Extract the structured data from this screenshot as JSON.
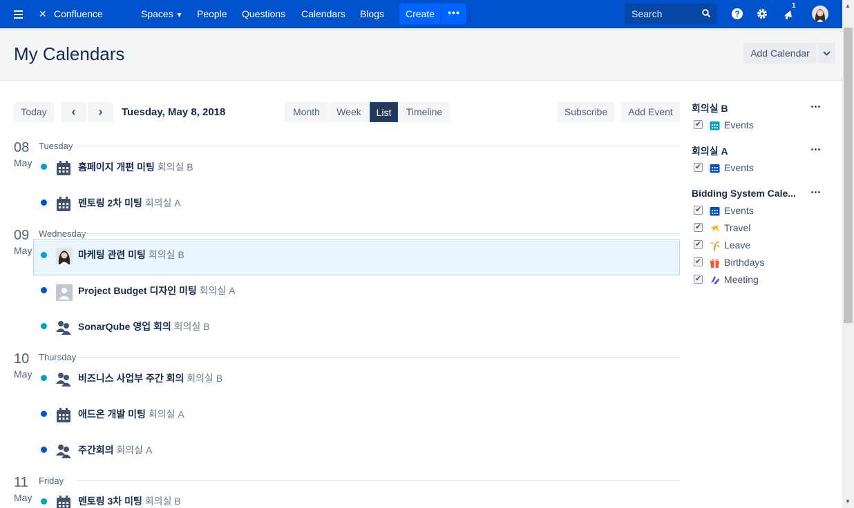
{
  "nav": {
    "brand": "Confluence",
    "spaces": "Spaces",
    "people": "People",
    "questions": "Questions",
    "calendars": "Calendars",
    "blogs": "Blogs",
    "create": "Create",
    "more": "•••",
    "search_placeholder": "Search",
    "notifications_count": "1"
  },
  "header": {
    "title": "My Calendars",
    "add_calendar": "Add Calendar"
  },
  "toolbar": {
    "today": "Today",
    "prev": "‹",
    "next": "›",
    "current_date": "Tuesday, May 8, 2018",
    "views": [
      "Month",
      "Week",
      "List",
      "Timeline"
    ],
    "active_view": "List",
    "subscribe": "Subscribe",
    "add_event": "Add Event"
  },
  "days": [
    {
      "num": "08",
      "month": "May",
      "weekday": "Tuesday",
      "events": [
        {
          "title": "홈페이지 개편 미팅",
          "room": "회의실 B",
          "color": "#00a3bf",
          "icon": "calendar-icon"
        },
        {
          "title": "멘토링 2차 미팅",
          "room": "회의실 A",
          "color": "#0052cc",
          "icon": "calendar-icon"
        }
      ]
    },
    {
      "num": "09",
      "month": "May",
      "weekday": "Wednesday",
      "events": [
        {
          "title": "마케팅 관련 미팅",
          "room": "회의실 B",
          "color": "#00a3bf",
          "icon": "user-photo"
        },
        {
          "title": "Project Budget 디자인 미팅",
          "room": "회의실 A",
          "color": "#0052cc",
          "icon": "default-avatar-icon"
        },
        {
          "title": "SonarQube 영업 회의",
          "room": "회의실 B",
          "color": "#00a3bf",
          "icon": "people-icon"
        }
      ]
    },
    {
      "num": "10",
      "month": "May",
      "weekday": "Thursday",
      "events": [
        {
          "title": "비즈니스 사업부 주간 회의",
          "room": "회의실 B",
          "color": "#00a3bf",
          "icon": "people-icon"
        },
        {
          "title": "애드온 개발 미팅",
          "room": "회의실 A",
          "color": "#0052cc",
          "icon": "calendar-icon"
        },
        {
          "title": "주간회의",
          "room": "회의실 A",
          "color": "#0052cc",
          "icon": "people-icon"
        }
      ]
    },
    {
      "num": "11",
      "month": "May",
      "weekday": "Friday",
      "events": [
        {
          "title": "멘토링 3차 미팅",
          "room": "회의실 B",
          "color": "#00a3bf",
          "icon": "calendar-icon"
        }
      ]
    }
  ],
  "sidebar": {
    "groups": [
      {
        "name": "회의실 B",
        "items": [
          {
            "label": "Events",
            "icon": "calendar-icon",
            "color": "#00a3bf"
          }
        ]
      },
      {
        "name": "회의실 A",
        "items": [
          {
            "label": "Events",
            "icon": "calendar-icon",
            "color": "#0052cc"
          }
        ]
      },
      {
        "name": "Bidding System Cale...",
        "items": [
          {
            "label": "Events",
            "icon": "calendar-icon",
            "color": "#0052cc"
          },
          {
            "label": "Travel",
            "icon": "plane-icon",
            "color": "#ffab00"
          },
          {
            "label": "Leave",
            "icon": "palm-tree-icon",
            "color": "#ff8b00"
          },
          {
            "label": "Birthdays",
            "icon": "gift-icon",
            "color": "#ff5630"
          },
          {
            "label": "Meeting",
            "icon": "meeting-icon",
            "color": "#6554c0"
          }
        ]
      }
    ]
  }
}
